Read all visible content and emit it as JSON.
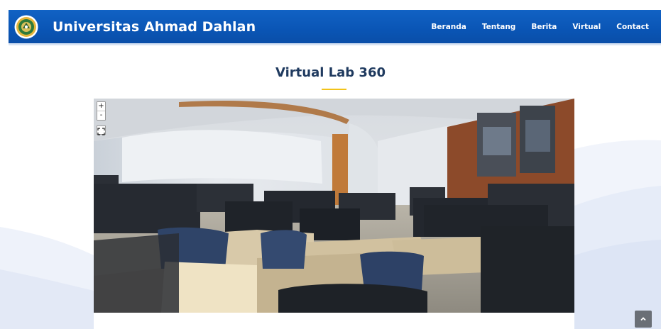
{
  "header": {
    "brand": "Universitas Ahmad Dahlan",
    "logo_icon": "university-seal-icon",
    "nav": [
      {
        "label": "Beranda"
      },
      {
        "label": "Tentang"
      },
      {
        "label": "Berita"
      },
      {
        "label": "Virtual"
      },
      {
        "label": "Contact"
      }
    ]
  },
  "main": {
    "title": "Virtual Lab 360",
    "viewer": {
      "zoom_in_label": "+",
      "zoom_out_label": "-",
      "fullscreen_icon": "fullscreen-icon",
      "scene": "computer-lab-panorama"
    }
  },
  "scroll_top": {
    "icon": "chevron-up-icon"
  },
  "colors": {
    "header": "#0a55b5",
    "title": "#1f3a5f",
    "accent": "#f2c31a",
    "scroll_button": "#6a6f76"
  }
}
